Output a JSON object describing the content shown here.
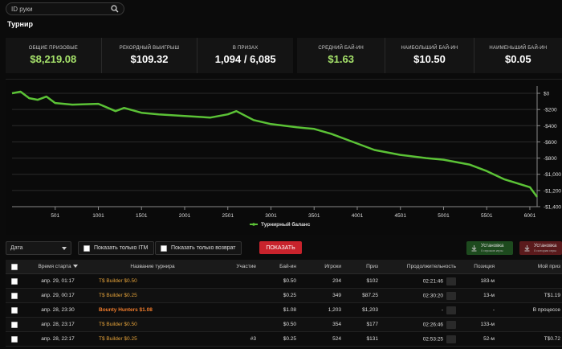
{
  "search": {
    "placeholder": "ID руки"
  },
  "page_title": "Турнир",
  "stats_left": [
    {
      "label": "ОБЩИЕ ПРИЗОВЫЕ",
      "value": "$8,219.08",
      "green": true
    },
    {
      "label": "РЕКОРДНЫЙ ВЫИГРЫШ",
      "value": "$109.32",
      "green": false
    },
    {
      "label": "В ПРИЗАХ",
      "value": "1,094 / 6,085",
      "green": false
    }
  ],
  "stats_right": [
    {
      "label": "СРЕДНИЙ БАЙ-ИН",
      "value": "$1.63",
      "green": true
    },
    {
      "label": "НАИБОЛЬШИЙ БАЙ-ИН",
      "value": "$10.50",
      "green": false
    },
    {
      "label": "НАИМЕНЬШИЙ БАЙ-ИН",
      "value": "$0.05",
      "green": false
    }
  ],
  "chart_data": {
    "type": "line",
    "series": [
      {
        "name": "Турнирный баланс",
        "color": "#5bc236",
        "x": [
          1,
          100,
          200,
          300,
          400,
          501,
          700,
          1001,
          1200,
          1300,
          1501,
          1700,
          2001,
          2300,
          2501,
          2600,
          2800,
          3001,
          3300,
          3501,
          3700,
          4001,
          4200,
          4500,
          4800,
          5001,
          5300,
          5501,
          5700,
          6001,
          6085
        ],
        "y": [
          0,
          20,
          -60,
          -80,
          -40,
          -120,
          -140,
          -130,
          -220,
          -180,
          -240,
          -260,
          -280,
          -300,
          -260,
          -220,
          -330,
          -380,
          -420,
          -440,
          -500,
          -620,
          -700,
          -760,
          -800,
          -820,
          -880,
          -960,
          -1060,
          -1160,
          -1280
        ]
      }
    ],
    "xticks": [
      "501",
      "1001",
      "1501",
      "2001",
      "2501",
      "3001",
      "3501",
      "4001",
      "4501",
      "5001",
      "5501",
      "6001"
    ],
    "yticks": [
      "$0",
      "-$200",
      "-$400",
      "-$600",
      "-$800",
      "-$1,000",
      "-$1,200",
      "-$1,400"
    ],
    "xlim": [
      1,
      6085
    ],
    "ylim": [
      -1400,
      50
    ],
    "legend_position": "bottom-center"
  },
  "filters": {
    "date_label": "Дата",
    "itm_label": "Показать только ITM",
    "refund_label": "Показать только возврат",
    "show_label": "ПОКАЗАТЬ",
    "install_green": {
      "title": "Установка",
      "sub": "0 игроков игры"
    },
    "install_red": {
      "title": "Установка",
      "sub": "0 история игры"
    }
  },
  "table": {
    "headers": {
      "start": "Время старта",
      "name": "Название турнира",
      "part": "Участие",
      "buyin": "Бай-ин",
      "players": "Игроки",
      "prize": "Приз",
      "duration": "Продолжительность",
      "position": "Позиция",
      "my_prize": "Мой приз"
    },
    "rows": [
      {
        "start": "апр. 29, 01:17",
        "name": "T$ Builder $0.50",
        "bold": false,
        "part": "",
        "buyin": "$0.50",
        "players": "204",
        "prize": "$102",
        "duration": "02:21:46",
        "position": "183-м",
        "my_prize": ""
      },
      {
        "start": "апр. 29, 00:17",
        "name": "T$ Builder $0.25",
        "bold": false,
        "part": "",
        "buyin": "$0.25",
        "players": "349",
        "prize": "$87.25",
        "duration": "02:30:20",
        "position": "13-м",
        "my_prize": "T$1.19"
      },
      {
        "start": "апр. 28, 23:30",
        "name": "Bounty Hunters $1.08",
        "bold": true,
        "part": "",
        "buyin": "$1.08",
        "players": "1,203",
        "prize": "$1,203",
        "duration": "-",
        "position": "-",
        "my_prize": "В процессе"
      },
      {
        "start": "апр. 28, 23:17",
        "name": "T$ Builder $0.50",
        "bold": false,
        "part": "",
        "buyin": "$0.50",
        "players": "354",
        "prize": "$177",
        "duration": "02:26:46",
        "position": "133-м",
        "my_prize": ""
      },
      {
        "start": "апр. 28, 22:17",
        "name": "T$ Builder $0.25",
        "bold": false,
        "part": "#3",
        "buyin": "$0.25",
        "players": "524",
        "prize": "$131",
        "duration": "02:53:25",
        "position": "52-м",
        "my_prize": "T$0.72"
      }
    ]
  }
}
